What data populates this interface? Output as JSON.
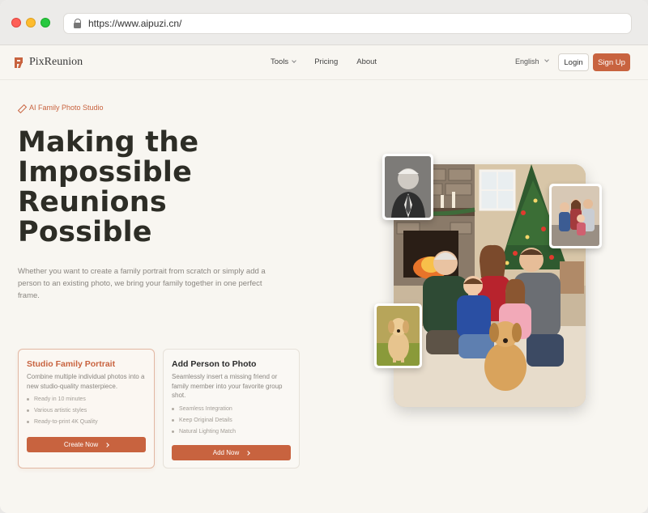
{
  "browser": {
    "url": "https://www.aipuzi.cn/"
  },
  "nav": {
    "brand": "PixReunion",
    "links": [
      {
        "label": "Tools"
      },
      {
        "label": "Pricing"
      },
      {
        "label": "About"
      }
    ],
    "language": "English",
    "login": "Login",
    "signup": "Sign Up"
  },
  "hero": {
    "tagline": "AI Family Photo Studio",
    "headline_lines": [
      "Making the",
      "Impossible",
      "Reunions",
      "Possible"
    ],
    "subtext": "Whether you want to create a family portrait from scratch or simply add a person to an existing photo, we bring your family together in one perfect frame."
  },
  "cards": [
    {
      "title": "Studio Family Portrait",
      "description": "Combine multiple individual photos into a new studio-quality masterpiece.",
      "features": [
        "Ready in 10 minutes",
        "Various artistic styles",
        "Ready-to-print 4K Quality"
      ],
      "button": "Create Now"
    },
    {
      "title": "Add Person to Photo",
      "description": "Seamlessly insert a missing friend or family member into your favorite group shot.",
      "features": [
        "Seamless Integration",
        "Keep Original Details",
        "Natural Lighting Match"
      ],
      "button": "Add Now"
    }
  ],
  "colors": {
    "accent": "#c8633f",
    "background": "#f8f6f1"
  }
}
